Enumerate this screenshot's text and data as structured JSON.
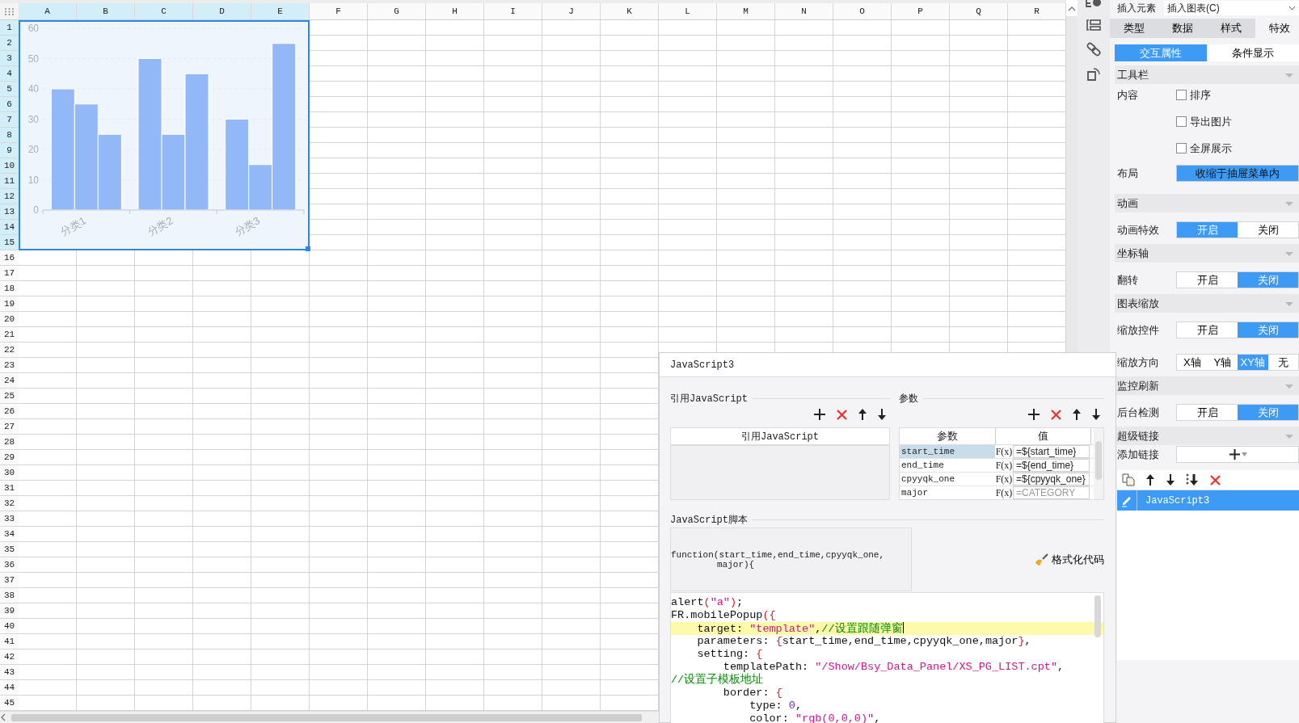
{
  "sheet": {
    "columns": [
      {
        "label": "A",
        "selected": true
      },
      {
        "label": "B",
        "selected": true
      },
      {
        "label": "C",
        "selected": true
      },
      {
        "label": "D",
        "selected": true
      },
      {
        "label": "E",
        "selected": true
      },
      {
        "label": "F",
        "selected": false
      },
      {
        "label": "G",
        "selected": false
      },
      {
        "label": "H",
        "selected": false
      },
      {
        "label": "I",
        "selected": false
      },
      {
        "label": "J",
        "selected": false
      },
      {
        "label": "K",
        "selected": false
      },
      {
        "label": "L",
        "selected": false
      },
      {
        "label": "M",
        "selected": false
      },
      {
        "label": "N",
        "selected": false
      },
      {
        "label": "O",
        "selected": false
      },
      {
        "label": "P",
        "selected": false
      },
      {
        "label": "Q",
        "selected": false
      },
      {
        "label": "R",
        "selected": false
      }
    ],
    "rows": [
      {
        "label": "1",
        "selected": true
      },
      {
        "label": "2",
        "selected": true
      },
      {
        "label": "3",
        "selected": true
      },
      {
        "label": "4",
        "selected": true
      },
      {
        "label": "5",
        "selected": true
      },
      {
        "label": "6",
        "selected": true
      },
      {
        "label": "7",
        "selected": true
      },
      {
        "label": "8",
        "selected": true
      },
      {
        "label": "9",
        "selected": true
      },
      {
        "label": "10",
        "selected": true
      },
      {
        "label": "11",
        "selected": true
      },
      {
        "label": "12",
        "selected": true
      },
      {
        "label": "13",
        "selected": true
      },
      {
        "label": "14",
        "selected": true
      },
      {
        "label": "15",
        "selected": true
      },
      {
        "label": "16",
        "selected": false
      },
      {
        "label": "17",
        "selected": false
      },
      {
        "label": "18",
        "selected": false
      },
      {
        "label": "19",
        "selected": false
      },
      {
        "label": "20",
        "selected": false
      },
      {
        "label": "21",
        "selected": false
      },
      {
        "label": "22",
        "selected": false
      },
      {
        "label": "23",
        "selected": false
      },
      {
        "label": "24",
        "selected": false
      },
      {
        "label": "25",
        "selected": false
      },
      {
        "label": "26",
        "selected": false
      },
      {
        "label": "27",
        "selected": false
      },
      {
        "label": "28",
        "selected": false
      },
      {
        "label": "29",
        "selected": false
      },
      {
        "label": "30",
        "selected": false
      },
      {
        "label": "31",
        "selected": false
      },
      {
        "label": "32",
        "selected": false
      },
      {
        "label": "33",
        "selected": false
      },
      {
        "label": "34",
        "selected": false
      },
      {
        "label": "35",
        "selected": false
      },
      {
        "label": "36",
        "selected": false
      },
      {
        "label": "37",
        "selected": false
      },
      {
        "label": "38",
        "selected": false
      },
      {
        "label": "39",
        "selected": false
      },
      {
        "label": "40",
        "selected": false
      },
      {
        "label": "41",
        "selected": false
      },
      {
        "label": "42",
        "selected": false
      },
      {
        "label": "43",
        "selected": false
      },
      {
        "label": "44",
        "selected": false
      },
      {
        "label": "45",
        "selected": false
      }
    ],
    "chart": {
      "chart_data": {
        "type": "bar",
        "categories": [
          "分类1",
          "分类2",
          "分类3"
        ],
        "series": [
          {
            "color": "#93b8f8",
            "values": [
              40,
              50,
              30
            ]
          },
          {
            "color": "#93b8f8",
            "values": [
              35,
              25,
              15
            ]
          },
          {
            "color": "#93b8f8",
            "values": [
              25,
              45,
              55
            ]
          }
        ],
        "grid": true,
        "ylim": [
          0,
          60
        ],
        "yticks": [
          0,
          10,
          20,
          30,
          40,
          50,
          60
        ]
      }
    }
  },
  "panel": {
    "insert": {
      "label": "插入元素",
      "value": "插入图表(C)"
    },
    "tabs": [
      {
        "label": "类型",
        "selected": false
      },
      {
        "label": "数据",
        "selected": false
      },
      {
        "label": "样式",
        "selected": false
      },
      {
        "label": "特效",
        "selected": true
      }
    ],
    "subtabs": [
      {
        "label": "交互属性",
        "selected": true
      },
      {
        "label": "条件显示",
        "selected": false
      }
    ],
    "sections": [
      {
        "title": "工具栏",
        "expanded": true,
        "rows": [
          {
            "kind": "checkboxes",
            "label": "内容",
            "options": [
              {
                "label": "排序",
                "checked": false
              },
              {
                "label": "导出图片",
                "checked": false
              },
              {
                "label": "全屏展示",
                "checked": false
              }
            ]
          },
          {
            "kind": "dropdown",
            "label": "布局",
            "value": "收缩于抽屉菜单内"
          }
        ]
      },
      {
        "title": "动画",
        "expanded": true,
        "rows": [
          {
            "kind": "segmented",
            "label": "动画特效",
            "options": [
              {
                "label": "开启",
                "selected": true
              },
              {
                "label": "关闭",
                "selected": false
              }
            ]
          }
        ]
      },
      {
        "title": "坐标轴",
        "expanded": true,
        "rows": [
          {
            "kind": "segmented",
            "label": "翻转",
            "options": [
              {
                "label": "开启",
                "selected": false
              },
              {
                "label": "关闭",
                "selected": true
              }
            ]
          }
        ]
      },
      {
        "title": "图表缩放",
        "expanded": true,
        "rows": [
          {
            "kind": "segmented",
            "label": "缩放控件",
            "options": [
              {
                "label": "开启",
                "selected": false
              },
              {
                "label": "关闭",
                "selected": true
              }
            ]
          },
          {
            "kind": "segmented",
            "label": "缩放方向",
            "options": [
              {
                "label": "X轴",
                "selected": false
              },
              {
                "label": "Y轴",
                "selected": false
              },
              {
                "label": "XY轴",
                "selected": true
              },
              {
                "label": "无",
                "selected": false
              }
            ]
          }
        ]
      },
      {
        "title": "监控刷新",
        "expanded": true,
        "rows": [
          {
            "kind": "segmented",
            "label": "后台检测",
            "options": [
              {
                "label": "开启",
                "selected": false
              },
              {
                "label": "关闭",
                "selected": true
              }
            ]
          }
        ]
      },
      {
        "title": "超级链接",
        "expanded": true,
        "rows": [
          {
            "kind": "add",
            "label": "添加链接"
          }
        ]
      }
    ],
    "links": [
      {
        "label": "JavaScript3",
        "selected": true
      }
    ]
  },
  "dialog": {
    "title": "JavaScript3",
    "imports": {
      "title": "引用JavaScript",
      "column": "引用JavaScript"
    },
    "params": {
      "title": "参数",
      "columns": [
        "参数",
        "值"
      ],
      "rows": [
        {
          "name": "start_time",
          "button": "F(x)",
          "value": "=${start_time}",
          "selected": true
        },
        {
          "name": "end_time",
          "button": "F(x)",
          "value": "=${end_time}",
          "selected": false
        },
        {
          "name": "cpyyqk_one",
          "button": "F(x)",
          "value": "=${cpyyqk_one}",
          "selected": false
        },
        {
          "name": "major",
          "button": "F(x)",
          "placeholder": "=CATEGORY",
          "selected": false
        }
      ]
    },
    "script": {
      "title": "JavaScript脚本",
      "signature": [
        "function(start_time,end_time,cpyyqk_one,",
        "major){"
      ],
      "format_button": "格式化代码",
      "lines": [
        {
          "current": false,
          "tokens": [
            {
              "kind": "plain",
              "text": "alert"
            },
            {
              "kind": "punct",
              "text": "("
            },
            {
              "kind": "string",
              "text": "\"a\""
            },
            {
              "kind": "punct",
              "text": ")"
            },
            {
              "kind": "plain",
              "text": ";"
            }
          ]
        },
        {
          "current": false,
          "tokens": [
            {
              "kind": "plain",
              "text": "FR.mobilePopup"
            },
            {
              "kind": "punct",
              "text": "({"
            }
          ]
        },
        {
          "current": true,
          "tokens": [
            {
              "kind": "plain",
              "text": "    target: "
            },
            {
              "kind": "string",
              "text": "\"template\""
            },
            {
              "kind": "plain",
              "text": ","
            },
            {
              "kind": "comment",
              "text": "//设置跟随弹窗"
            }
          ]
        },
        {
          "current": false,
          "tokens": [
            {
              "kind": "plain",
              "text": "    parameters: "
            },
            {
              "kind": "punct",
              "text": "{"
            },
            {
              "kind": "plain",
              "text": "start_time,end_time,cpyyqk_one,major"
            },
            {
              "kind": "punct",
              "text": "}"
            },
            {
              "kind": "plain",
              "text": ","
            }
          ]
        },
        {
          "current": false,
          "tokens": [
            {
              "kind": "plain",
              "text": "    setting: "
            },
            {
              "kind": "punct",
              "text": "{"
            }
          ]
        },
        {
          "current": false,
          "tokens": [
            {
              "kind": "plain",
              "text": "        templatePath: "
            },
            {
              "kind": "string",
              "text": "\"/Show/Bsy_Data_Panel/XS_PG_LIST.cpt\""
            },
            {
              "kind": "plain",
              "text": ","
            }
          ]
        },
        {
          "current": false,
          "tokens": [
            {
              "kind": "comment",
              "text": "//设置子模板地址"
            }
          ]
        },
        {
          "current": false,
          "tokens": [
            {
              "kind": "plain",
              "text": "        border: "
            },
            {
              "kind": "punct",
              "text": "{"
            }
          ]
        },
        {
          "current": false,
          "tokens": [
            {
              "kind": "plain",
              "text": "            type: "
            },
            {
              "kind": "number",
              "text": "0"
            },
            {
              "kind": "plain",
              "text": ","
            }
          ]
        },
        {
          "current": false,
          "tokens": [
            {
              "kind": "plain",
              "text": "            color: "
            },
            {
              "kind": "string",
              "text": "\"rgb(0,0,0)\""
            },
            {
              "kind": "plain",
              "text": ","
            }
          ]
        }
      ]
    }
  }
}
